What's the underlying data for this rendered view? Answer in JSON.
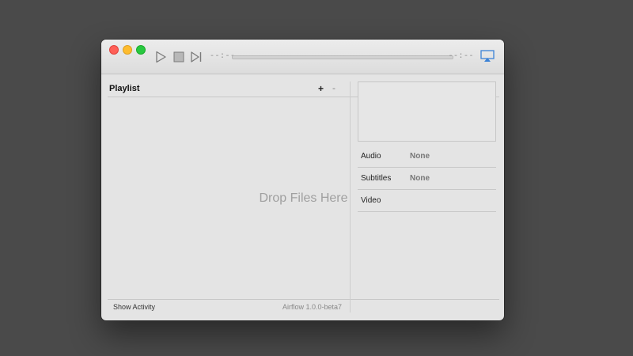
{
  "titlebar": {
    "time_left": "--:--",
    "time_right": "--:--",
    "controls": [
      "play-icon",
      "stop-icon",
      "next-icon"
    ],
    "airplay_icon": "airplay-icon"
  },
  "playlist": {
    "title": "Playlist",
    "add_label": "+",
    "remove_label": "-",
    "drop_text": "Drop Files Here",
    "show_activity": "Show Activity",
    "version": "Airflow 1.0.0-beta7"
  },
  "info": {
    "audio_label": "Audio",
    "audio_value": "None",
    "subtitles_label": "Subtitles",
    "subtitles_value": "None",
    "video_label": "Video"
  },
  "colors": {
    "desktop": "#4a4a4a",
    "window": "#e4e4e4",
    "close": "#ff5f57",
    "minimize": "#febc2e",
    "zoom": "#28c840",
    "accent": "#3b82d6"
  }
}
